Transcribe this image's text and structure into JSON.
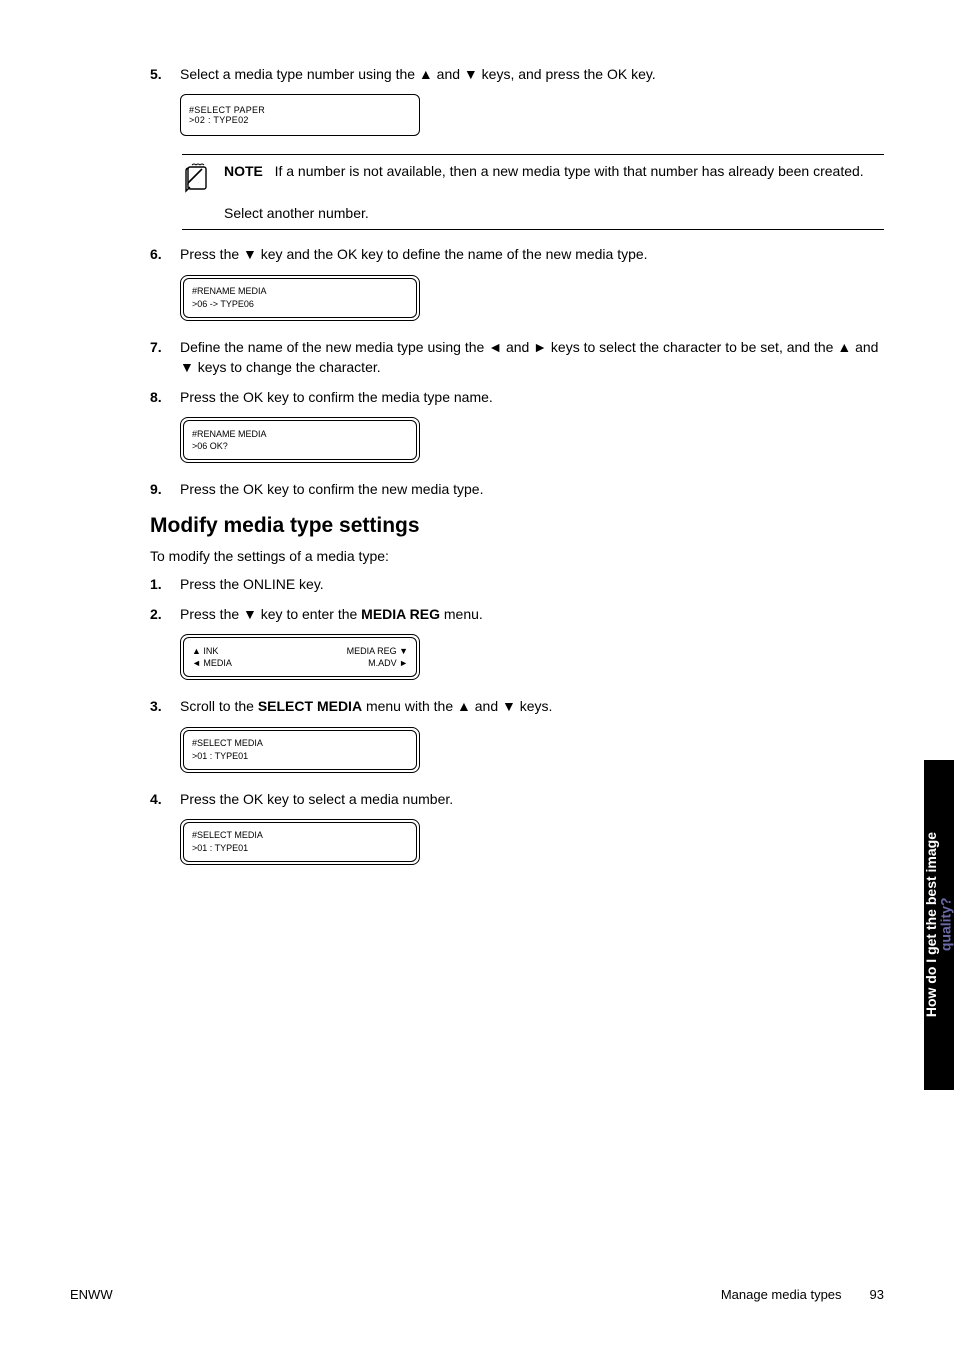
{
  "steps": {
    "s5": {
      "num": "5.",
      "text": "Select a media type number using the ▲ and ▼ keys, and press the OK key."
    },
    "s6": {
      "num": "6.",
      "text": "Press the ▼ key and the OK key to define the name of the new media type."
    },
    "s7": {
      "num": "7.",
      "text": "Define the name of the new media type using the ◄ and ► keys to select the character to be set, and the ▲ and ▼ keys to change the character."
    },
    "s8": {
      "num": "8.",
      "text": "Press the OK key to confirm the media type name."
    },
    "s9": {
      "num": "9.",
      "text": "Press the OK key to confirm the new media type."
    },
    "m1": {
      "num": "1.",
      "text": "Press the ONLINE key."
    },
    "m2": {
      "num": "2.",
      "text_a": "Press the ▼ key to enter the ",
      "bold": "MEDIA REG",
      "text_b": " menu."
    },
    "m3": {
      "num": "3.",
      "text_a": "Scroll to the ",
      "bold": "SELECT MEDIA",
      "text_b": " menu with the ▲ and ▼ keys."
    },
    "m4": {
      "num": "4.",
      "text": "Press the OK key to select a media number."
    }
  },
  "lcd": {
    "a": {
      "l1": "#SELECT PAPER",
      "l2": ">02 : TYPE02"
    },
    "b": {
      "l1": "#RENAME MEDIA",
      "l2": ">06 -> TYPE06"
    },
    "c": {
      "l1": "#RENAME MEDIA",
      "l2": ">06 OK?"
    },
    "d": {
      "r1l": "▲ INK",
      "r1r": "MEDIA REG ▼",
      "r2l": "◄ MEDIA",
      "r2r": "M.ADV ►"
    },
    "e": {
      "l1": "#SELECT MEDIA",
      "l2": ">01 : TYPE01"
    },
    "f": {
      "l1": "#SELECT MEDIA",
      "l2": ">01 : TYPE01"
    }
  },
  "note": {
    "label": "NOTE",
    "body": "If a number is not available, then a new media type with that number has already been created.",
    "sub": "Select another number."
  },
  "heading": "Modify media type settings",
  "intro": "To modify the settings of a media type:",
  "sidetab": {
    "line1": "How do I get the best image",
    "line2": "quality?"
  },
  "footer": {
    "left": "ENWW",
    "mid": "Manage media types",
    "page": "93"
  }
}
